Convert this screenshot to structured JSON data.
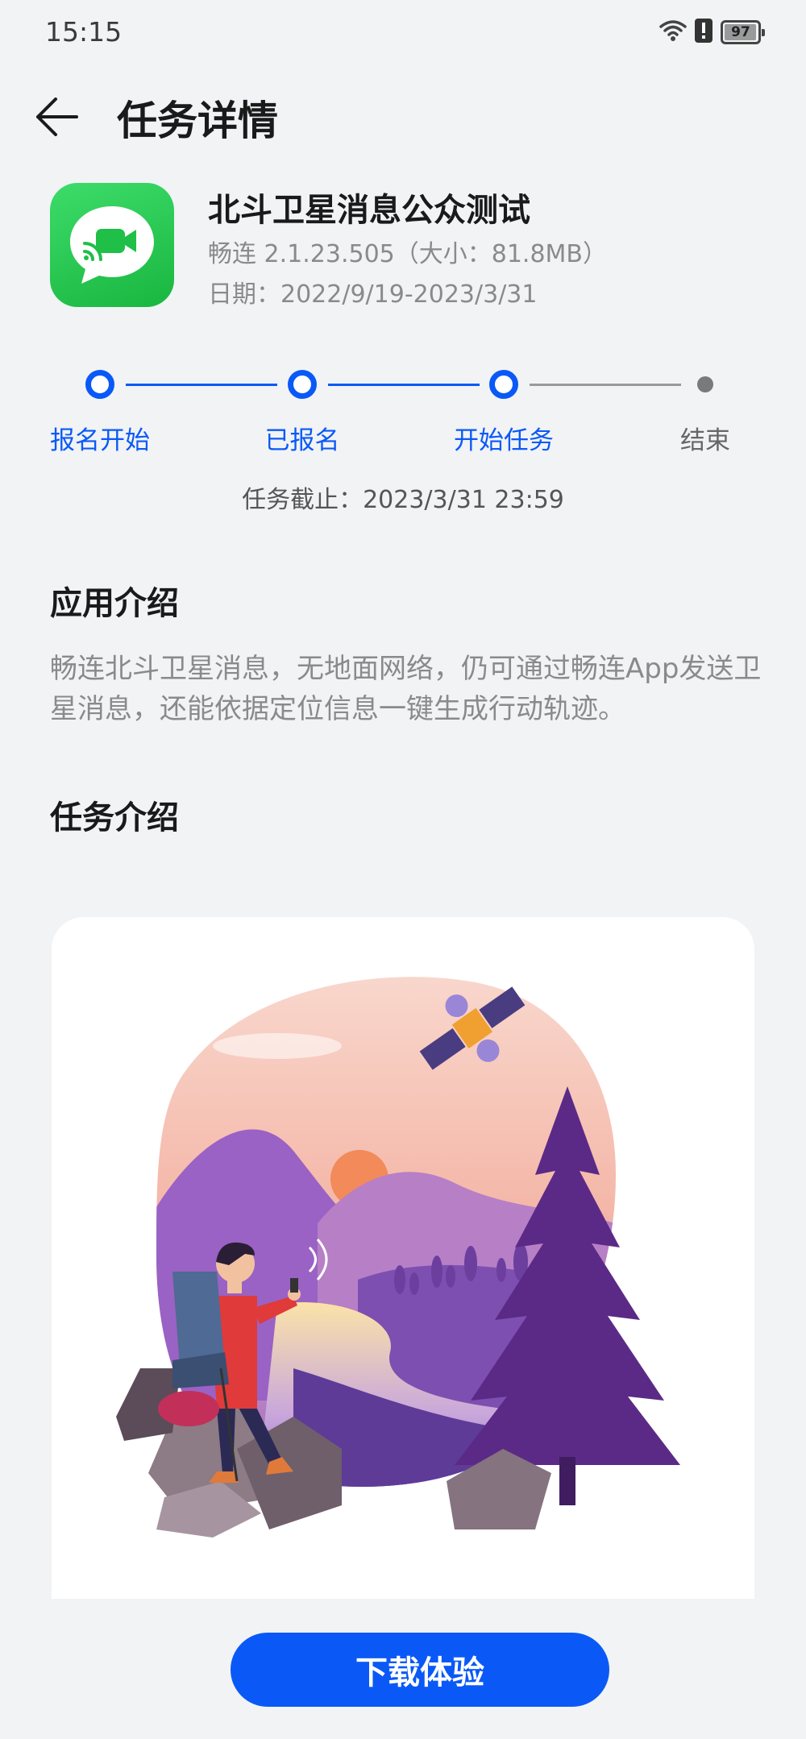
{
  "status_bar": {
    "time": "15:15",
    "battery": "97",
    "battery_level": 0.97
  },
  "header": {
    "title": "任务详情"
  },
  "app": {
    "name": "北斗卫星消息公众测试",
    "version": "畅连 2.1.23.505（大小：81.8MB）",
    "date": "日期：2022/9/19-2023/3/31",
    "icon": "video-chat-icon"
  },
  "progress": {
    "steps": [
      {
        "label": "报名开始",
        "state": "done"
      },
      {
        "label": "已报名",
        "state": "done"
      },
      {
        "label": "开始任务",
        "state": "current"
      },
      {
        "label": "结束",
        "state": "pending"
      }
    ],
    "deadline": "任务截止：2023/3/31 23:59"
  },
  "app_intro": {
    "title": "应用介绍",
    "text": "畅连北斗卫星消息，无地面网络，仍可通过畅连App发送卫星消息，还能依据定位信息一键生成行动轨迹。"
  },
  "task_intro": {
    "title": "任务介绍"
  },
  "download_button": {
    "label": "下载体验"
  },
  "colors": {
    "accent": "#0a59f7",
    "background": "#f1f3f5",
    "app_icon": "#1fbf48"
  }
}
